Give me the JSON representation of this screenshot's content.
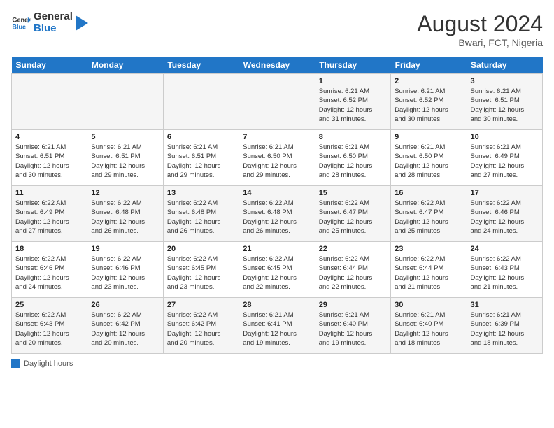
{
  "header": {
    "logo_general": "General",
    "logo_blue": "Blue",
    "month_year": "August 2024",
    "location": "Bwari, FCT, Nigeria"
  },
  "weekdays": [
    "Sunday",
    "Monday",
    "Tuesday",
    "Wednesday",
    "Thursday",
    "Friday",
    "Saturday"
  ],
  "legend_label": "Daylight hours",
  "weeks": [
    [
      {
        "day": "",
        "info": ""
      },
      {
        "day": "",
        "info": ""
      },
      {
        "day": "",
        "info": ""
      },
      {
        "day": "",
        "info": ""
      },
      {
        "day": "1",
        "info": "Sunrise: 6:21 AM\nSunset: 6:52 PM\nDaylight: 12 hours\nand 31 minutes."
      },
      {
        "day": "2",
        "info": "Sunrise: 6:21 AM\nSunset: 6:52 PM\nDaylight: 12 hours\nand 30 minutes."
      },
      {
        "day": "3",
        "info": "Sunrise: 6:21 AM\nSunset: 6:51 PM\nDaylight: 12 hours\nand 30 minutes."
      }
    ],
    [
      {
        "day": "4",
        "info": "Sunrise: 6:21 AM\nSunset: 6:51 PM\nDaylight: 12 hours\nand 30 minutes."
      },
      {
        "day": "5",
        "info": "Sunrise: 6:21 AM\nSunset: 6:51 PM\nDaylight: 12 hours\nand 29 minutes."
      },
      {
        "day": "6",
        "info": "Sunrise: 6:21 AM\nSunset: 6:51 PM\nDaylight: 12 hours\nand 29 minutes."
      },
      {
        "day": "7",
        "info": "Sunrise: 6:21 AM\nSunset: 6:50 PM\nDaylight: 12 hours\nand 29 minutes."
      },
      {
        "day": "8",
        "info": "Sunrise: 6:21 AM\nSunset: 6:50 PM\nDaylight: 12 hours\nand 28 minutes."
      },
      {
        "day": "9",
        "info": "Sunrise: 6:21 AM\nSunset: 6:50 PM\nDaylight: 12 hours\nand 28 minutes."
      },
      {
        "day": "10",
        "info": "Sunrise: 6:21 AM\nSunset: 6:49 PM\nDaylight: 12 hours\nand 27 minutes."
      }
    ],
    [
      {
        "day": "11",
        "info": "Sunrise: 6:22 AM\nSunset: 6:49 PM\nDaylight: 12 hours\nand 27 minutes."
      },
      {
        "day": "12",
        "info": "Sunrise: 6:22 AM\nSunset: 6:48 PM\nDaylight: 12 hours\nand 26 minutes."
      },
      {
        "day": "13",
        "info": "Sunrise: 6:22 AM\nSunset: 6:48 PM\nDaylight: 12 hours\nand 26 minutes."
      },
      {
        "day": "14",
        "info": "Sunrise: 6:22 AM\nSunset: 6:48 PM\nDaylight: 12 hours\nand 26 minutes."
      },
      {
        "day": "15",
        "info": "Sunrise: 6:22 AM\nSunset: 6:47 PM\nDaylight: 12 hours\nand 25 minutes."
      },
      {
        "day": "16",
        "info": "Sunrise: 6:22 AM\nSunset: 6:47 PM\nDaylight: 12 hours\nand 25 minutes."
      },
      {
        "day": "17",
        "info": "Sunrise: 6:22 AM\nSunset: 6:46 PM\nDaylight: 12 hours\nand 24 minutes."
      }
    ],
    [
      {
        "day": "18",
        "info": "Sunrise: 6:22 AM\nSunset: 6:46 PM\nDaylight: 12 hours\nand 24 minutes."
      },
      {
        "day": "19",
        "info": "Sunrise: 6:22 AM\nSunset: 6:46 PM\nDaylight: 12 hours\nand 23 minutes."
      },
      {
        "day": "20",
        "info": "Sunrise: 6:22 AM\nSunset: 6:45 PM\nDaylight: 12 hours\nand 23 minutes."
      },
      {
        "day": "21",
        "info": "Sunrise: 6:22 AM\nSunset: 6:45 PM\nDaylight: 12 hours\nand 22 minutes."
      },
      {
        "day": "22",
        "info": "Sunrise: 6:22 AM\nSunset: 6:44 PM\nDaylight: 12 hours\nand 22 minutes."
      },
      {
        "day": "23",
        "info": "Sunrise: 6:22 AM\nSunset: 6:44 PM\nDaylight: 12 hours\nand 21 minutes."
      },
      {
        "day": "24",
        "info": "Sunrise: 6:22 AM\nSunset: 6:43 PM\nDaylight: 12 hours\nand 21 minutes."
      }
    ],
    [
      {
        "day": "25",
        "info": "Sunrise: 6:22 AM\nSunset: 6:43 PM\nDaylight: 12 hours\nand 20 minutes."
      },
      {
        "day": "26",
        "info": "Sunrise: 6:22 AM\nSunset: 6:42 PM\nDaylight: 12 hours\nand 20 minutes."
      },
      {
        "day": "27",
        "info": "Sunrise: 6:22 AM\nSunset: 6:42 PM\nDaylight: 12 hours\nand 20 minutes."
      },
      {
        "day": "28",
        "info": "Sunrise: 6:21 AM\nSunset: 6:41 PM\nDaylight: 12 hours\nand 19 minutes."
      },
      {
        "day": "29",
        "info": "Sunrise: 6:21 AM\nSunset: 6:40 PM\nDaylight: 12 hours\nand 19 minutes."
      },
      {
        "day": "30",
        "info": "Sunrise: 6:21 AM\nSunset: 6:40 PM\nDaylight: 12 hours\nand 18 minutes."
      },
      {
        "day": "31",
        "info": "Sunrise: 6:21 AM\nSunset: 6:39 PM\nDaylight: 12 hours\nand 18 minutes."
      }
    ]
  ]
}
